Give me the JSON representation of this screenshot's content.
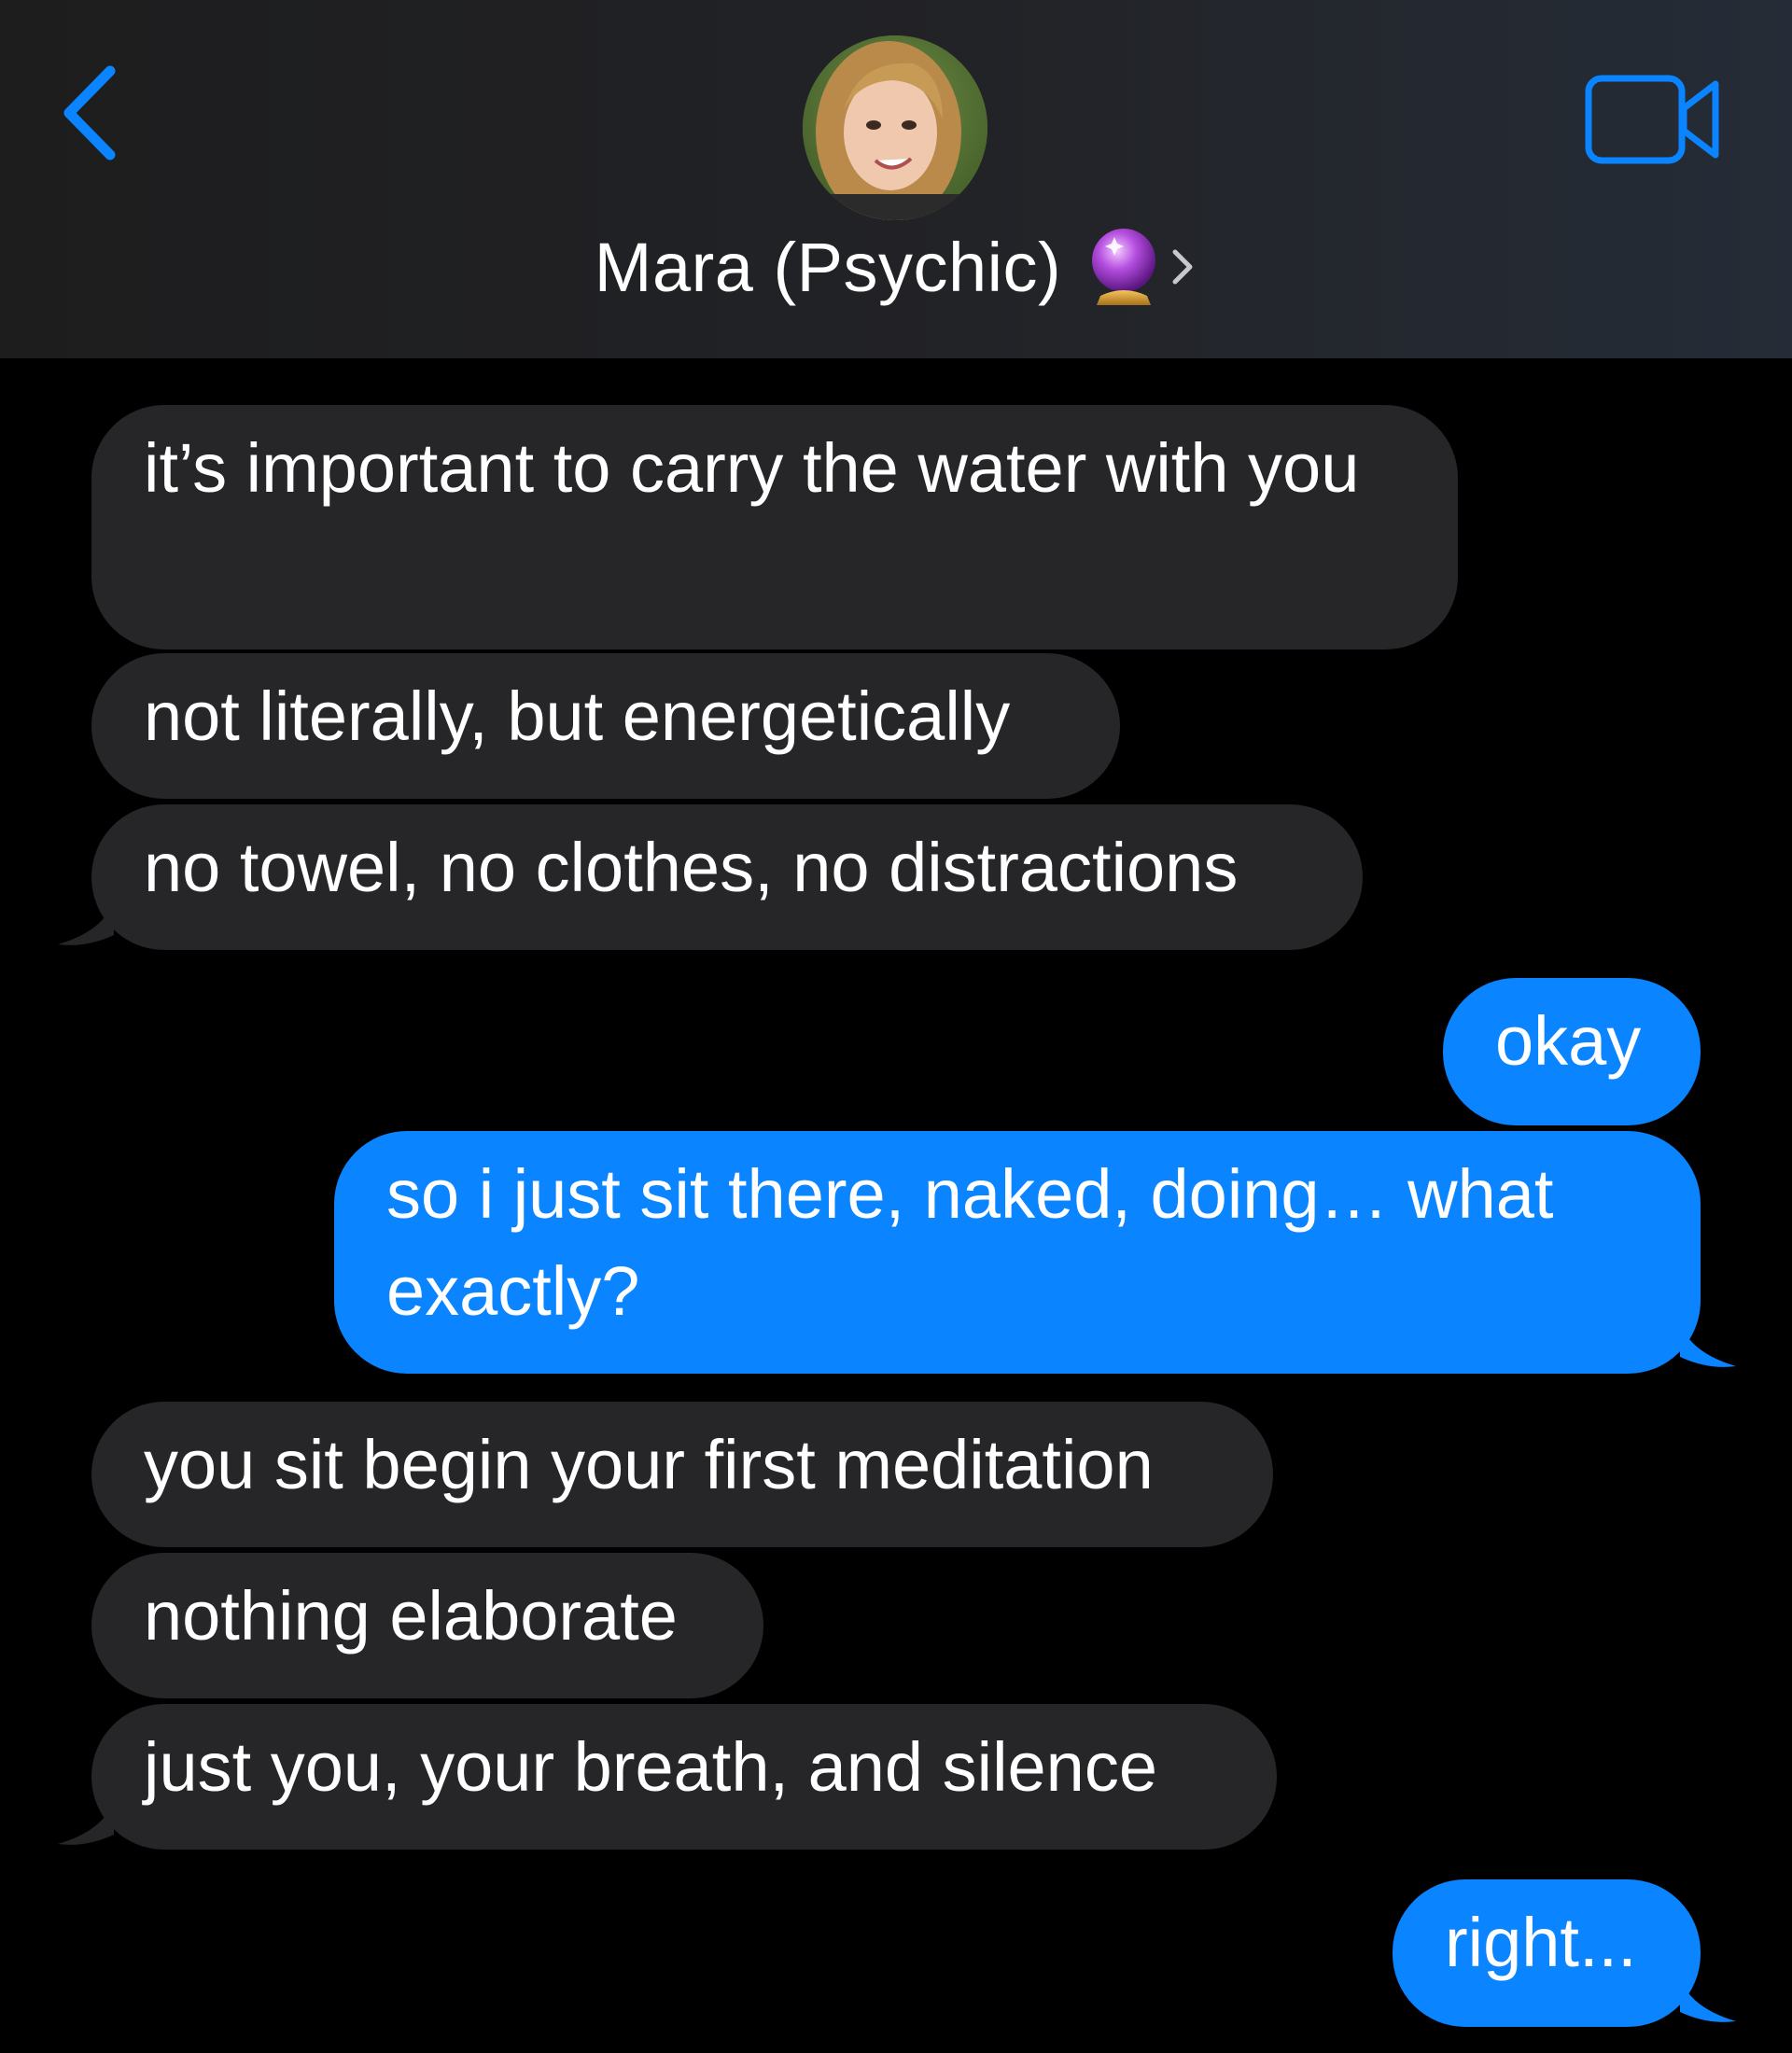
{
  "header": {
    "contact_name": "Mara (Psychic)",
    "contact_emoji": "crystal-ball",
    "back_icon": "chevron-left-icon",
    "video_icon": "video-camera-icon",
    "accent_color": "#0a84ff"
  },
  "messages": [
    {
      "sender": "contact",
      "text": "it’s important to carry the water with you"
    },
    {
      "sender": "contact",
      "text": "not literally, but energetically"
    },
    {
      "sender": "contact",
      "text": "no towel, no clothes, no distractions"
    },
    {
      "sender": "me",
      "text": "okay"
    },
    {
      "sender": "me",
      "text": "so i just sit there, naked, doing… what exactly?"
    },
    {
      "sender": "contact",
      "text": "you sit begin your first meditation"
    },
    {
      "sender": "contact",
      "text": "nothing elaborate"
    },
    {
      "sender": "contact",
      "text": "just you, your breath, and silence"
    },
    {
      "sender": "me",
      "text": "right..."
    }
  ],
  "colors": {
    "received_bubble": "#262628",
    "sent_bubble": "#0a84ff",
    "background": "#000000"
  }
}
